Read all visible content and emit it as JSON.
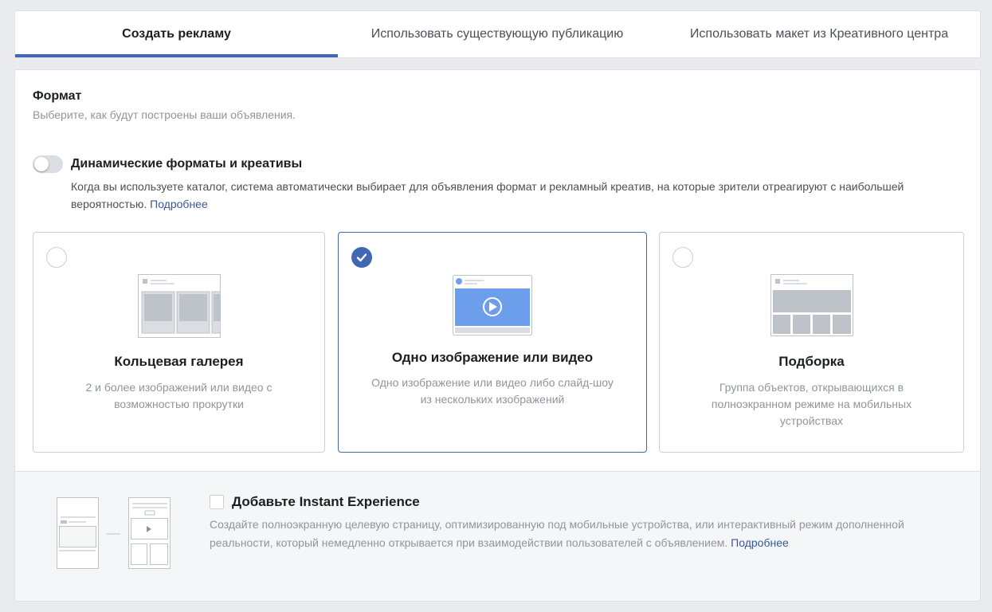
{
  "tabs": [
    {
      "label": "Создать рекламу",
      "active": true
    },
    {
      "label": "Использовать существующую публикацию",
      "active": false
    },
    {
      "label": "Использовать макет из Креативного центра",
      "active": false
    }
  ],
  "format": {
    "title": "Формат",
    "subtitle": "Выберите, как будут построены ваши объявления."
  },
  "dynamic": {
    "toggle_on": false,
    "title": "Динамические форматы и креативы",
    "description": "Когда вы используете каталог, система автоматически выбирает для объявления формат и рекламный креатив, на которые зрители отреагируют с наибольшей вероятностью.",
    "link": "Подробнее"
  },
  "cards": [
    {
      "title": "Кольцевая галерея",
      "description": "2 и более изображений или видео с возможностью прокрутки",
      "selected": false
    },
    {
      "title": "Одно изображение или видео",
      "description": "Одно изображение или видео либо слайд-шоу из нескольких изображений",
      "selected": true
    },
    {
      "title": "Подборка",
      "description": "Группа объектов, открывающихся в полноэкранном режиме на мобильных устройствах",
      "selected": false
    }
  ],
  "instant_experience": {
    "checked": false,
    "title": "Добавьте Instant Experience",
    "description": "Создайте полноэкранную целевую страницу, оптимизированную под мобильные устройства, или интерактивный режим дополненной реальности, который немедленно открывается при взаимодействии пользователей с объявлением.",
    "link": "Подробнее"
  },
  "colors": {
    "accent": "#4267b2",
    "link": "#365899",
    "illustration_blue": "#6d9eeb",
    "illustration_gray": "#bec2c9"
  }
}
